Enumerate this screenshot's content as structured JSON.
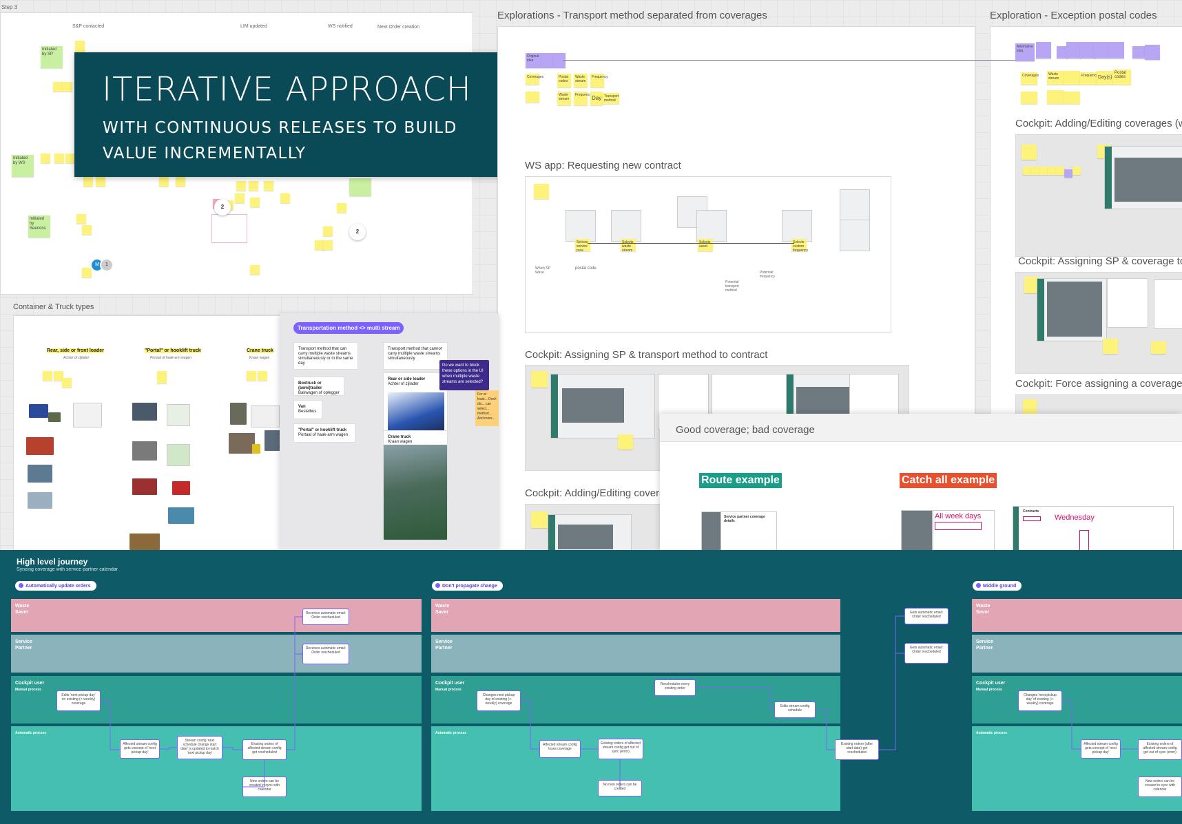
{
  "hero": {
    "title": "ITERATIVE APPROACH",
    "subtitle": "WITH CONTINUOUS RELEASES TO BUILD VALUE INCREMENTALLY"
  },
  "frames": {
    "step3": "Step 3",
    "step3_columns": [
      "S&P contacted",
      "LIM updated",
      "WS notified",
      "Next Order creation"
    ],
    "step3_rows": [
      "Initiated by SP",
      "Initiated by WS",
      "Initiated by Seenons"
    ],
    "explorations_transport": "Explorations - Transport method separated from coverages",
    "exploration_postal": "Exploration - Exception postal codes",
    "cockpit_adding_w": "Cockpit: Adding/Editing coverages (w",
    "cockpit_assigning_sp_cov": "Cockpit: Assigning SP & coverage to",
    "cockpit_force": "Cockpit: Force assigning a coverage",
    "ws_app": "WS app: Requesting new contract",
    "cockpit_assign_transport": "Cockpit: Assigning SP & transport method to contract",
    "cockpit_adding": "Cockpit: Adding/Editing covera",
    "container_truck": "Container & Truck types",
    "good_bad": "Good coverage; bad coverage"
  },
  "transport_panel": {
    "header": "Transportation method <> multi stream",
    "card_can": "Transport method that can carry multiple waste streams simultaneously or in the same day",
    "card_cannot": "Transport method that cannot carry multiple waste streams simultaneously",
    "item_boxtruck": "Boxtruck or (semi)trailer",
    "item_boxtruck_nl": "Bakwagen of oplegger",
    "item_van": "Van",
    "item_van_nl": "Bestelbus",
    "item_portal": "\"Portal\" or hooklift truck",
    "item_portal_nl": "Portaal of haak-arm wagen",
    "item_rear": "Rear or side loader",
    "item_rear_nl": "Achter of zijlader",
    "item_crane": "Crane truck",
    "item_crane_nl": "Kraan wagen",
    "note_purple": "Do we want to block these options in the UI when multiple waste streams are selected?",
    "note_orange": "For at least... Don't dis... can select... method... And more..."
  },
  "container_types": {
    "rear": "Rear, side or front loader",
    "rear_nl": "Achter of zijlader",
    "portal": "\"Portal\" or hooklift truck",
    "portal_nl": "Portaal of haak-arm wagen",
    "crane": "Crane truck",
    "crane_nl": "Kraan wagen"
  },
  "coverage": {
    "route": "Route example",
    "catch_all": "Catch all example",
    "all_week_days": "All week days",
    "wednesday": "Wednesday",
    "contracts": "Contracts",
    "sp_details": "Service partner coverage details"
  },
  "explorations": {
    "original": "Original idea",
    "coverages": "Coverages",
    "postal_codes": "Postal codes",
    "waste_stream": "Waste stream",
    "frequency": "Frequency",
    "day": "Day",
    "days": "Day(s)",
    "transport_method": "Transport method",
    "alternative": "Alternative idea"
  },
  "ws_flow": [
    "Selects service pure",
    "Selects waste stream",
    "Selects asset",
    "Selects custom frequency",
    "postal code",
    "Which SP Wave",
    "Potential transport method",
    "Potential frequency"
  ],
  "journey": {
    "title": "High level journey",
    "subtitle": "Syncing coverage with service partner calendar",
    "options": [
      {
        "pill": "Automatically update orders",
        "lanes": [
          "Waste Saver",
          "Service Partner",
          "Cockpit user",
          "Automatic process"
        ],
        "manual": "Manual process",
        "boxes": [
          "Receives automatic email: Order rescheduled",
          "Receives automatic email: Order rescheduled",
          "Edits 'next pickup day' on existing (>-weekly) coverage",
          "Affected stream config gets concept of 'next pickup day'",
          "Stream config 'next schedule change start date' is updated to match 'next pickup day'",
          "Existing orders of affected stream config get rescheduled",
          "New orders can be created in sync with calendar"
        ]
      },
      {
        "pill": "Don't propagate change",
        "lanes": [
          "Waste Saver",
          "Service Partner",
          "Cockpit user",
          "Automatic process"
        ],
        "manual": "Manual process",
        "boxes": [
          "Gets automatic email: Order rescheduled",
          "Gets automatic email: Order rescheduled",
          "Changes next pickup day of existing (>-weekly) coverage",
          "Affected stream config loses coverage",
          "Existing orders of affected stream config get out of sync (error)",
          "No new orders can be created",
          "Reschedules every existing order",
          "Edits stream config schedule",
          "Existing orders (after start date) get rescheduled"
        ]
      },
      {
        "pill": "Middle ground",
        "lanes": [
          "Waste Saver",
          "Service Partner",
          "Cockpit user",
          "Automatic process"
        ],
        "manual": "Manual process",
        "boxes": [
          "Changes 'next pickup day' of existing (>-weekly) coverage",
          "Affected stream config gets concept of 'next pickup day'",
          "Existing orders of affected stream config get out of sync (error)",
          "New orders can be created in sync with calendar"
        ]
      }
    ]
  },
  "colors": {
    "hero_bg": "#0a4a57",
    "journey_bg": "#0e5a66",
    "lane_waste": "#e2a5b3",
    "lane_partner": "#8bb3bc",
    "lane_cockpit": "#2f9e93",
    "lane_auto": "#45bfb0",
    "route_tag": "#1a9e8a",
    "catch_tag": "#e8502e",
    "accent_purple": "#7b61ff"
  }
}
